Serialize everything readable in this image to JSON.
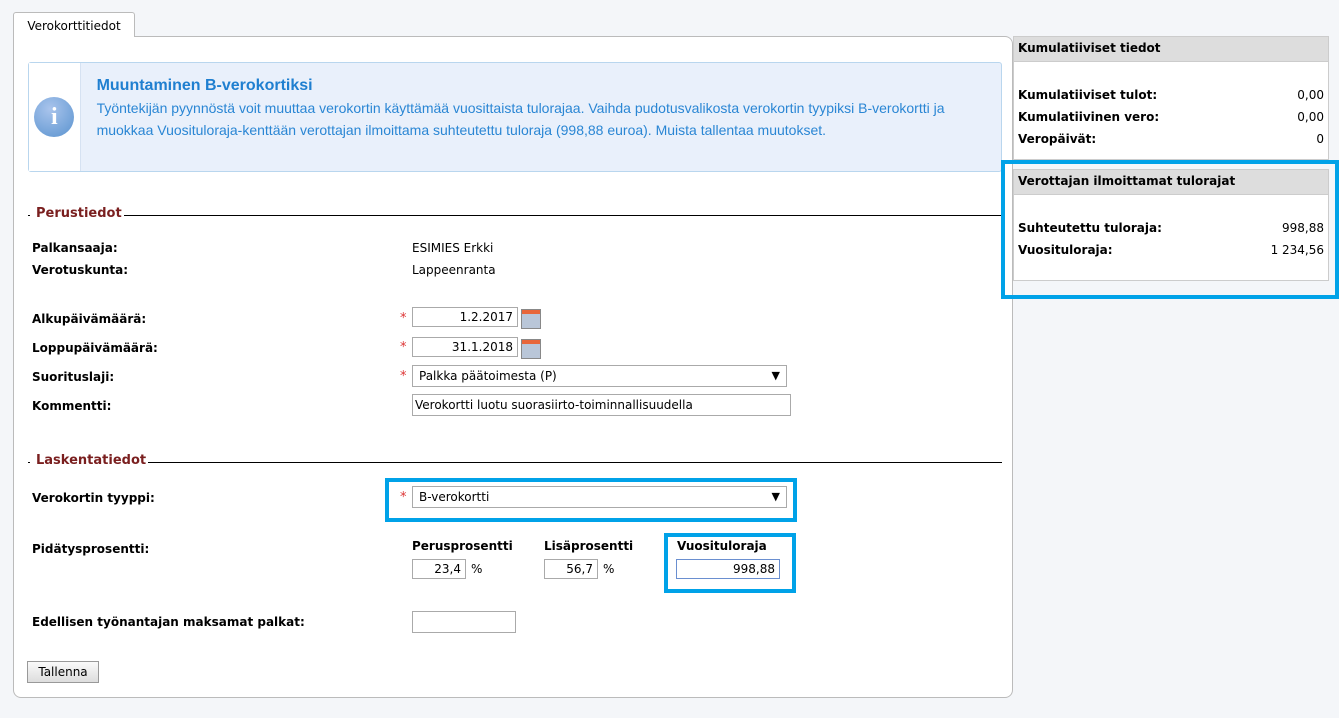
{
  "tab": "Verokorttitiedot",
  "info": {
    "title": "Muuntaminen B-verokortiksi",
    "text": "Työntekijän pyynnöstä voit muuttaa verokortin käyttämää vuosittaista tulorajaa. Vaihda pudotusvalikosta verokortin tyypiksi B-verokortti ja muokkaa Vuosituloraja-kenttään verottajan ilmoittama suhteutettu tuloraja (998,88 euroa). Muista tallentaa muutokset.",
    "icon": "i"
  },
  "perustiedot": {
    "title": "Perustiedot",
    "palkansaaja_label": "Palkansaaja:",
    "palkansaaja": "ESIMIES Erkki",
    "verotuskunta_label": "Verotuskunta:",
    "verotuskunta": "Lappeenranta",
    "alku_label": "Alkupäivämäärä:",
    "alku": "1.2.2017",
    "loppu_label": "Loppupäivämäärä:",
    "loppu": "31.1.2018",
    "suorituslaji_label": "Suorituslaji:",
    "suorituslaji": "Palkka päätoimesta (P)",
    "kommentti_label": "Kommentti:",
    "kommentti": "Verokortti luotu suorasiirto-toiminnallisuudella"
  },
  "laskenta": {
    "title": "Laskentatiedot",
    "tyyppi_label": "Verokortin tyyppi:",
    "tyyppi": "B-verokortti",
    "pidatys_label": "Pidätysprosentti:",
    "perus_label": "Perusprosentti",
    "perus": "23,4",
    "lisa_label": "Lisäprosentti",
    "lisa": "56,7",
    "pct": "%",
    "vuosi_label": "Vuosituloraja",
    "vuosi": "998,88",
    "edellinen_label": "Edellisen työnantajan maksamat palkat:",
    "edellinen": ""
  },
  "save": "Tallenna",
  "required": "*",
  "kumulatiiviset": {
    "title": "Kumulatiiviset tiedot",
    "rows": [
      {
        "k": "Kumulatiiviset tulot:",
        "v": "0,00"
      },
      {
        "k": "Kumulatiivinen vero:",
        "v": "0,00"
      },
      {
        "k": "Veropäivät:",
        "v": "0"
      }
    ]
  },
  "verottaja": {
    "title": "Verottajan ilmoittamat tulorajat",
    "rows": [
      {
        "k": "Suhteutettu tuloraja:",
        "v": "998,88"
      },
      {
        "k": "Vuosituloraja:",
        "v": "1 234,56"
      }
    ]
  }
}
